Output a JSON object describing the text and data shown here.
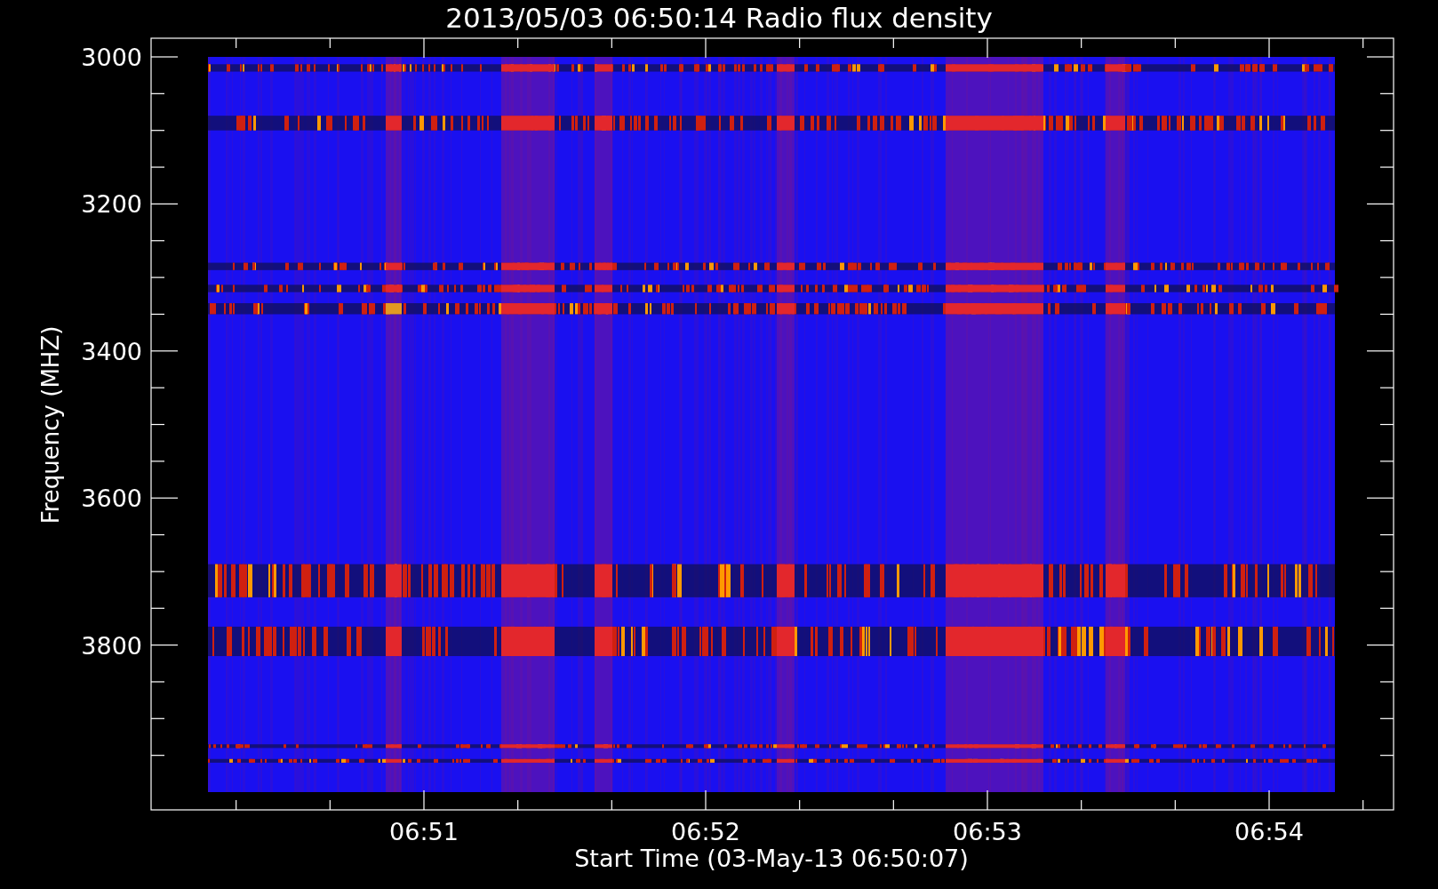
{
  "title": "2013/05/03 06:50:14 Radio flux density",
  "y_axis": {
    "label": "Frequency (MHZ)",
    "ticks": [
      "3000",
      "3200",
      "3400",
      "3600",
      "3800"
    ]
  },
  "x_axis": {
    "label": "Start Time (03-May-13 06:50:07)",
    "ticks": [
      "06:51",
      "06:52",
      "06:53",
      "06:54"
    ]
  }
}
